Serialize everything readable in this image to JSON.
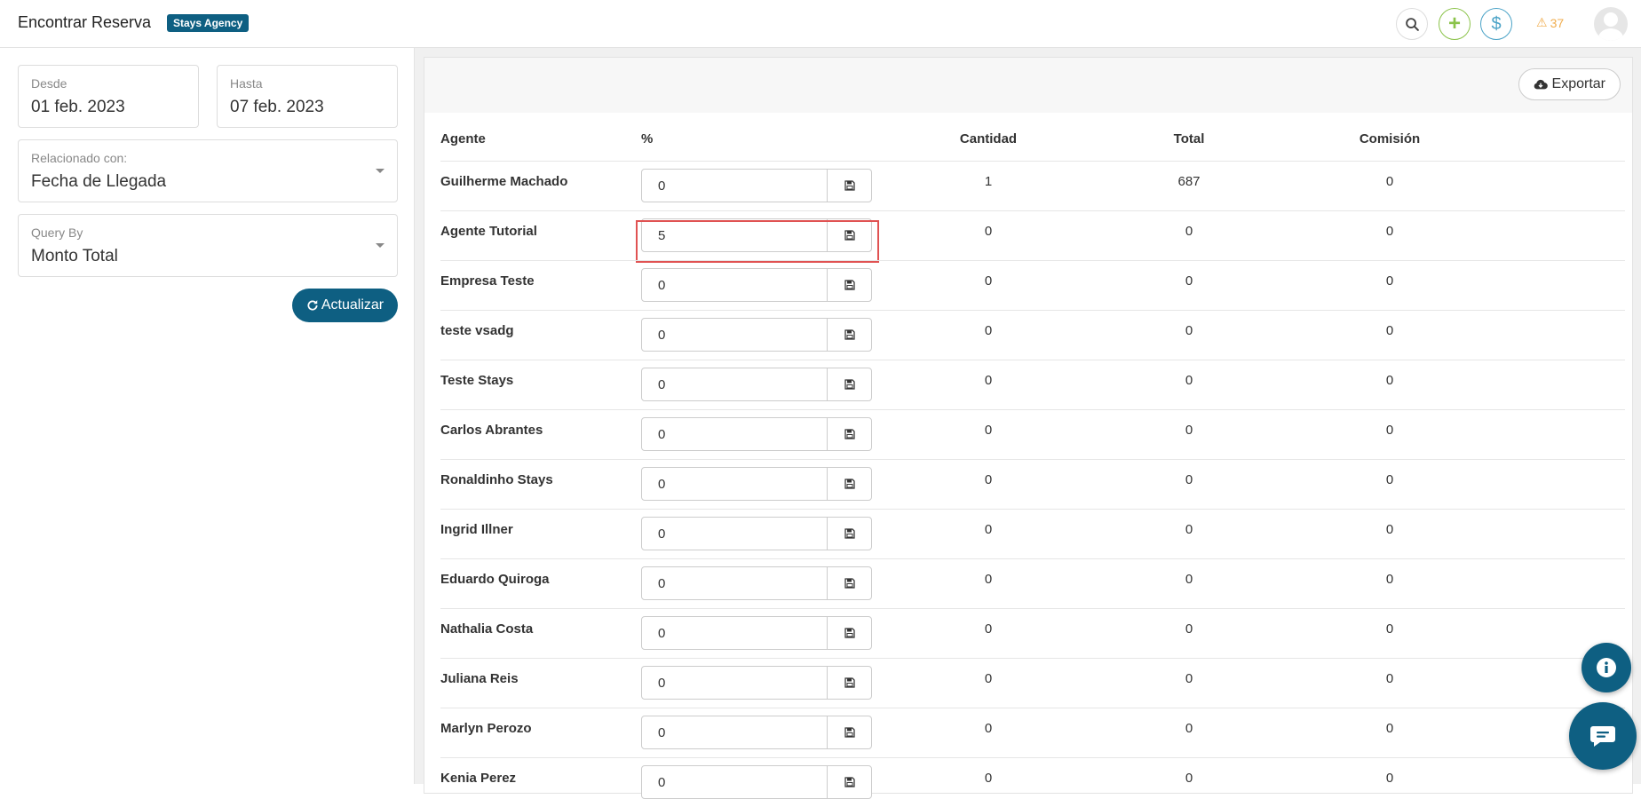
{
  "header": {
    "title": "Encontrar Reserva",
    "agency_badge": "Stays Agency",
    "alert_count": "37"
  },
  "filters": {
    "desde": {
      "label": "Desde",
      "value": "01 feb. 2023"
    },
    "hasta": {
      "label": "Hasta",
      "value": "07 feb. 2023"
    },
    "relacionado": {
      "label": "Relacionado con:",
      "value": "Fecha de Llegada"
    },
    "query_by": {
      "label": "Query By",
      "value": "Monto Total"
    },
    "actualizar_label": "Actualizar"
  },
  "toolbar": {
    "export_label": "Exportar"
  },
  "table": {
    "headers": {
      "agente": "Agente",
      "pct": "%",
      "cantidad": "Cantidad",
      "total": "Total",
      "comision": "Comisión"
    },
    "rows": [
      {
        "name": "Guilherme Machado",
        "pct": "0",
        "cantidad": "1",
        "total": "687",
        "comision": "0"
      },
      {
        "name": "Agente Tutorial",
        "pct": "5",
        "cantidad": "0",
        "total": "0",
        "comision": "0"
      },
      {
        "name": "Empresa Teste",
        "pct": "0",
        "cantidad": "0",
        "total": "0",
        "comision": "0"
      },
      {
        "name": "teste vsadg",
        "pct": "0",
        "cantidad": "0",
        "total": "0",
        "comision": "0"
      },
      {
        "name": "Teste Stays",
        "pct": "0",
        "cantidad": "0",
        "total": "0",
        "comision": "0"
      },
      {
        "name": "Carlos Abrantes",
        "pct": "0",
        "cantidad": "0",
        "total": "0",
        "comision": "0"
      },
      {
        "name": "Ronaldinho Stays",
        "pct": "0",
        "cantidad": "0",
        "total": "0",
        "comision": "0"
      },
      {
        "name": "Ingrid Illner",
        "pct": "0",
        "cantidad": "0",
        "total": "0",
        "comision": "0"
      },
      {
        "name": "Eduardo Quiroga",
        "pct": "0",
        "cantidad": "0",
        "total": "0",
        "comision": "0"
      },
      {
        "name": "Nathalia Costa",
        "pct": "0",
        "cantidad": "0",
        "total": "0",
        "comision": "0"
      },
      {
        "name": "Juliana Reis",
        "pct": "0",
        "cantidad": "0",
        "total": "0",
        "comision": "0"
      },
      {
        "name": "Marlyn Perozo",
        "pct": "0",
        "cantidad": "0",
        "total": "0",
        "comision": "0"
      },
      {
        "name": "Kenia Perez",
        "pct": "0",
        "cantidad": "0",
        "total": "0",
        "comision": "0"
      }
    ]
  },
  "colors": {
    "primary": "#0e5f82",
    "add": "#8bc34a",
    "dollar": "#4ba3c7",
    "alert": "#f0ad4e",
    "highlight": "#e05252"
  }
}
